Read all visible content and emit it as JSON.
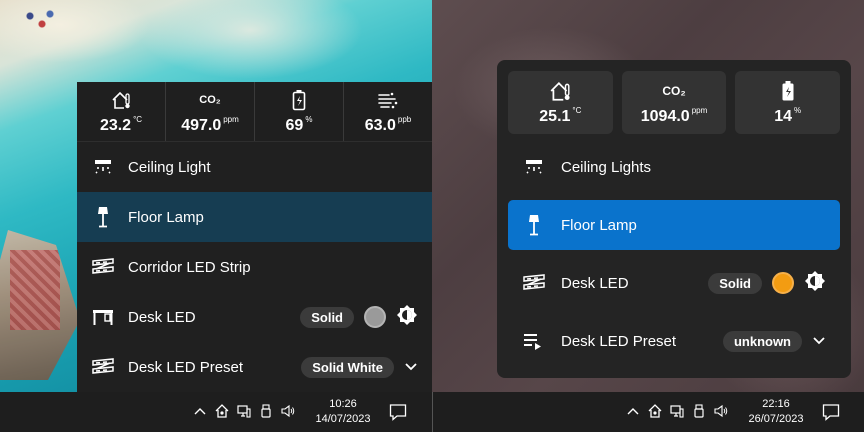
{
  "left": {
    "sensors": [
      {
        "icon": "home-thermometer-icon",
        "value": "23.2",
        "unit": "°C"
      },
      {
        "icon": "co2-icon",
        "value": "497.0",
        "unit": "ppm"
      },
      {
        "icon": "battery-icon",
        "value": "69",
        "unit": "%"
      },
      {
        "icon": "air-quality-icon",
        "value": "63.0",
        "unit": "ppb"
      }
    ],
    "rows": [
      {
        "icon": "ceiling-light-icon",
        "label": "Ceiling Light"
      },
      {
        "icon": "floor-lamp-icon",
        "label": "Floor Lamp",
        "active": true
      },
      {
        "icon": "led-strip-icon",
        "label": "Corridor LED Strip"
      },
      {
        "icon": "desk-icon",
        "label": "Desk LED",
        "mode": "Solid",
        "color": "#9a9a9a"
      },
      {
        "icon": "led-strip-icon",
        "label": "Desk LED Preset",
        "preset": "Solid White"
      }
    ],
    "taskbar": {
      "time": "10:26",
      "date": "14/07/2023"
    }
  },
  "right": {
    "sensors": [
      {
        "icon": "home-thermometer-icon",
        "value": "25.1",
        "unit": "°C"
      },
      {
        "icon": "co2-icon",
        "value": "1094.0",
        "unit": "ppm"
      },
      {
        "icon": "battery-charging-icon",
        "value": "14",
        "unit": "%"
      }
    ],
    "rows": [
      {
        "icon": "ceiling-light-icon",
        "label": "Ceiling Lights"
      },
      {
        "icon": "floor-lamp-icon",
        "label": "Floor Lamp",
        "active": true
      },
      {
        "icon": "led-strip-icon",
        "label": "Desk LED",
        "mode": "Solid",
        "color": "#f39c12"
      },
      {
        "icon": "playlist-icon",
        "label": "Desk LED Preset",
        "preset": "unknown"
      }
    ],
    "taskbar": {
      "time": "22:16",
      "date": "26/07/2023"
    }
  },
  "co2_glyph": "CO₂",
  "colors": {
    "left_active": "#163d52",
    "right_active": "#0a73cc",
    "panel": "#202020"
  }
}
